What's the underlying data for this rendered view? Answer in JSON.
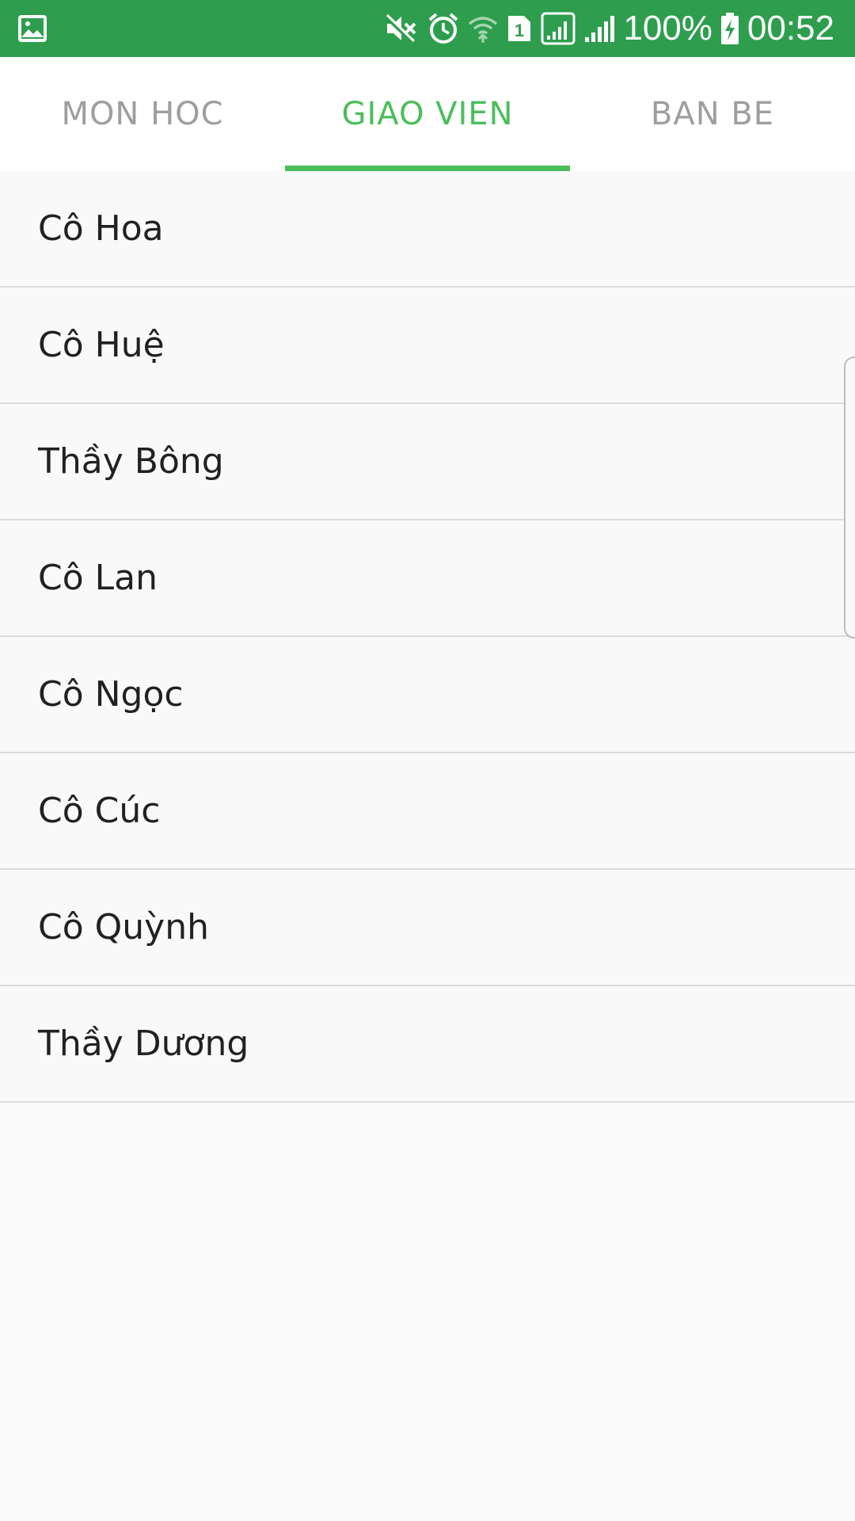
{
  "status_bar": {
    "battery": "100%",
    "time": "00:52",
    "sim_label": "1",
    "icons": [
      "gallery-icon",
      "mute-icon",
      "alarm-icon",
      "wifi-icon",
      "sim-icon",
      "signal-icon",
      "signal-icon-2",
      "battery-charging-icon"
    ],
    "background": "#2e9e4e"
  },
  "tabs": [
    {
      "label": "MON HOC",
      "active": false
    },
    {
      "label": "GIAO VIEN",
      "active": true
    },
    {
      "label": "BAN BE",
      "active": false
    }
  ],
  "accent": "#4cbd5c",
  "teachers": [
    "Cô Hoa",
    "Cô Huệ",
    "Thầy Bông",
    "Cô Lan",
    "Cô Ngọc",
    "Cô Cúc",
    "Cô Quỳnh",
    "Thầy Dương"
  ]
}
